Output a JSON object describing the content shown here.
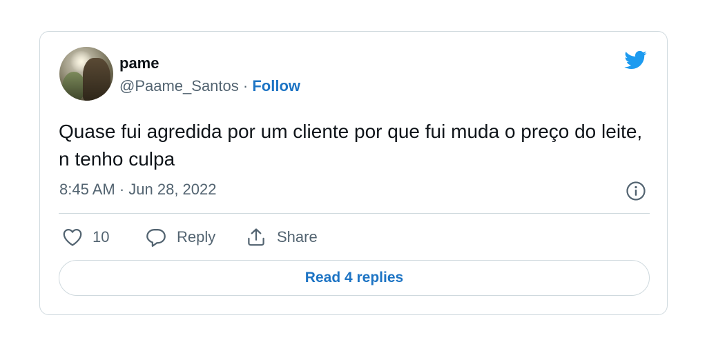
{
  "user": {
    "name": "pame",
    "handle": "@Paame_Santos",
    "separator": " · ",
    "follow_label": "Follow"
  },
  "tweet": {
    "text": "Quase fui agredida por um cliente por que fui muda o preço do leite, n tenho culpa",
    "timestamp": "8:45 AM · Jun 28, 2022"
  },
  "actions": {
    "likes_count": "10",
    "reply_label": "Reply",
    "share_label": "Share"
  },
  "read_replies_label": "Read 4 replies",
  "colors": {
    "brand": "#1d9bf0",
    "link": "#1d74c4",
    "text": "#0f1419",
    "secondary": "#536471",
    "border": "#cfd9de"
  },
  "icons": [
    "twitter-bird-icon",
    "info-icon",
    "heart-icon",
    "reply-bubble-icon",
    "share-icon"
  ]
}
